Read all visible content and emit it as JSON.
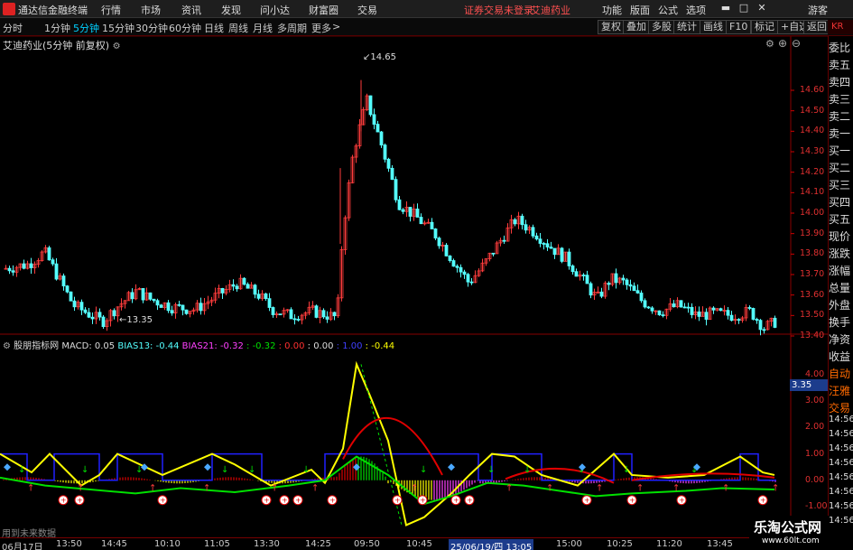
{
  "titlebar": {
    "app_title": "通达信金融终端",
    "menu": [
      "行情",
      "市场",
      "资讯",
      "发现",
      "问小达",
      "财富圈",
      "交易"
    ],
    "notice": "证券交易未登录",
    "stock": "艾迪药业",
    "right_menu": [
      "功能",
      "版面",
      "公式",
      "选项"
    ],
    "user": "游客"
  },
  "toolbar": {
    "periods": [
      "分时",
      "1分钟",
      "5分钟",
      "15分钟",
      "30分钟",
      "60分钟",
      "日线",
      "周线",
      "月线",
      "多周期",
      "更多"
    ],
    "active_period": "5分钟",
    "more_icon": ">",
    "right_buttons": [
      "复权",
      "叠加",
      "多股",
      "统计",
      "画线",
      "F10",
      "标记",
      "+自选",
      "返回"
    ]
  },
  "chart": {
    "stock_label": "艾迪药业(5分钟 前复权)",
    "high_label": "14.65",
    "low_label": "13.35",
    "price_ticks": [
      "14.60",
      "14.50",
      "14.40",
      "14.30",
      "14.20",
      "14.10",
      "14.00",
      "13.90",
      "13.80",
      "13.70",
      "13.60",
      "13.50",
      "13.40"
    ],
    "current_price": "3.35",
    "ind_ticks": [
      "4.00",
      "3.00",
      "2.00",
      "1.00",
      "0.00",
      "-1.00"
    ]
  },
  "indicator": {
    "name": "股朋指标网",
    "macd": "MACD: 0.05",
    "bias13": "BIAS13: -0.44",
    "bias21": "BIAS21: -0.32",
    "v1": ": -0.32",
    "v2": ": 0.00",
    "v3": ": 0.00",
    "v4": ": 1.00",
    "v5": ": -0.44",
    "future_note": "用到未来数据"
  },
  "right_panel": [
    "委比",
    "卖五",
    "卖四",
    "卖三",
    "卖二",
    "卖一",
    "买一",
    "买二",
    "买三",
    "买四",
    "买五",
    "现价",
    "涨跌",
    "涨幅",
    "总量",
    "外盘",
    "换手",
    "净资",
    "收益",
    "自动",
    "汪雅",
    "交易",
    "14:56",
    "14:56",
    "14:56",
    "14:56",
    "14:56",
    "14:56",
    "14:56",
    "14:56"
  ],
  "time_axis": [
    "06月17日",
    "13:50",
    "14:45",
    "10:10",
    "11:05",
    "13:30",
    "14:25",
    "09:50",
    "10:45",
    "25/06/19/四 13:05",
    "15:00",
    "10:25",
    "11:20",
    "13:45"
  ],
  "watermark": {
    "title": "乐淘公式网",
    "url": "www.60lt.com"
  },
  "colors": {
    "up": "#ff3c3c",
    "down": "#54ffff",
    "yellow": "#ffff00",
    "green": "#00e000",
    "red": "#e00000",
    "blue": "#2020ff",
    "magenta": "#ff40ff"
  }
}
